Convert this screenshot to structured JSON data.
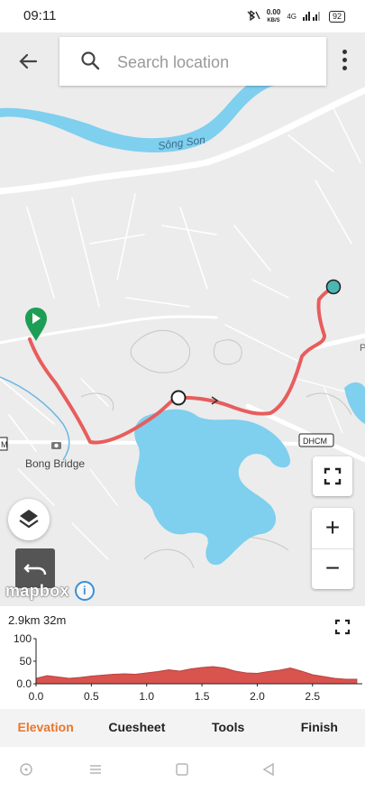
{
  "status_bar": {
    "time": "09:11",
    "speed_value": "0.00",
    "speed_unit": "KB/S",
    "network": "4G",
    "battery": "92"
  },
  "search": {
    "placeholder": "Search location",
    "value": ""
  },
  "map": {
    "labels": {
      "river": "Sông Son",
      "bridge": "Bong Bridge",
      "road_shield_left": "M",
      "road_shield_right": "DHCM",
      "edge_letter": "P"
    },
    "attribution": "mapbox",
    "zoom_in": "+",
    "zoom_out": "−",
    "colors": {
      "route": "#e85d5d",
      "water": "#7fcfee",
      "land": "#ececec",
      "start_marker": "#1e9e55",
      "end_marker": "#4bb7b0"
    }
  },
  "elevation": {
    "summary": "2.9km 32m",
    "colors": {
      "fill": "#d9534f"
    }
  },
  "chart_data": {
    "type": "area",
    "title": "",
    "xlabel": "",
    "ylabel": "",
    "xlim": [
      0.0,
      2.95
    ],
    "ylim": [
      0.0,
      100
    ],
    "x_ticks": [
      "0.0",
      "0.5",
      "1.0",
      "1.5",
      "2.0",
      "2.5"
    ],
    "y_ticks": [
      "0.0",
      "50",
      "100"
    ],
    "x": [
      0.0,
      0.1,
      0.2,
      0.3,
      0.4,
      0.5,
      0.6,
      0.7,
      0.8,
      0.9,
      1.0,
      1.1,
      1.2,
      1.3,
      1.4,
      1.5,
      1.6,
      1.7,
      1.8,
      1.9,
      2.0,
      2.1,
      2.2,
      2.3,
      2.4,
      2.5,
      2.6,
      2.7,
      2.8,
      2.9
    ],
    "series": [
      {
        "values": [
          12,
          18,
          15,
          12,
          14,
          17,
          19,
          21,
          22,
          21,
          24,
          27,
          31,
          28,
          33,
          36,
          38,
          35,
          28,
          24,
          23,
          27,
          30,
          35,
          28,
          20,
          16,
          12,
          10,
          10
        ]
      }
    ]
  },
  "tabs": [
    {
      "label": "Elevation",
      "active": true
    },
    {
      "label": "Cuesheet",
      "active": false
    },
    {
      "label": "Tools",
      "active": false
    },
    {
      "label": "Finish",
      "active": false
    }
  ]
}
